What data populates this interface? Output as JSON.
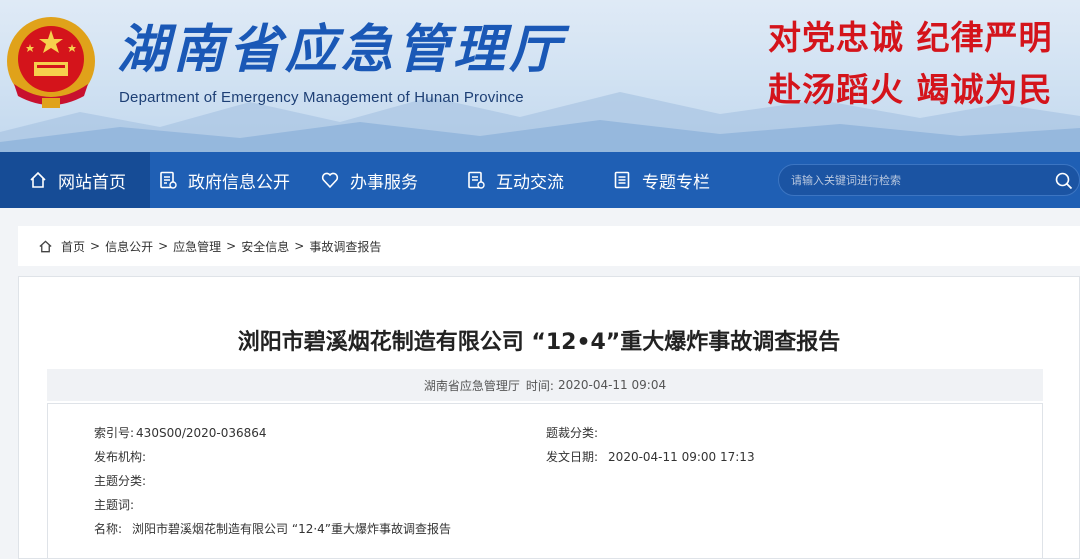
{
  "header": {
    "title": "湖南省应急管理厅",
    "subtitle": "Department of Emergency Management of Hunan Province",
    "slogan_line1": "对党忠诚  纪律严明",
    "slogan_line2": "赴汤蹈火  竭诚为民"
  },
  "nav": {
    "items": [
      {
        "label": "网站首页",
        "icon": "home-icon"
      },
      {
        "label": "政府信息公开",
        "icon": "document-icon"
      },
      {
        "label": "办事服务",
        "icon": "heart-icon"
      },
      {
        "label": "互动交流",
        "icon": "chat-icon"
      },
      {
        "label": "专题专栏",
        "icon": "list-icon"
      }
    ],
    "search_placeholder": "请输入关键词进行检索"
  },
  "breadcrumb": [
    "首页",
    "信息公开",
    "应急管理",
    "安全信息",
    "事故调查报告"
  ],
  "breadcrumb_sep": ">",
  "article": {
    "title": "浏阳市碧溪烟花制造有限公司 “12•4”重大爆炸事故调查报告",
    "source": "湖南省应急管理厅",
    "time_label": "时间:",
    "time_value": "2020-04-11 09:04"
  },
  "info": {
    "index_label": "索引号:",
    "index_value": "430S00/2020-036864",
    "category_label": "题裁分类:",
    "category_value": "",
    "publisher_label": "发布机构:",
    "publisher_value": "",
    "date_label": "发文日期:",
    "date_value": "2020-04-11 09:00 17:13",
    "topic_label": "主题分类:",
    "topic_value": "",
    "keyword_label": "主题词:",
    "keyword_value": "",
    "name_label": "名称:",
    "name_value": "浏阳市碧溪烟花制造有限公司 “12·4”重大爆炸事故调查报告"
  },
  "colors": {
    "nav_bg": "#1f5fb4",
    "title_blue": "#1a58b6",
    "slogan_red": "#d4141b"
  }
}
